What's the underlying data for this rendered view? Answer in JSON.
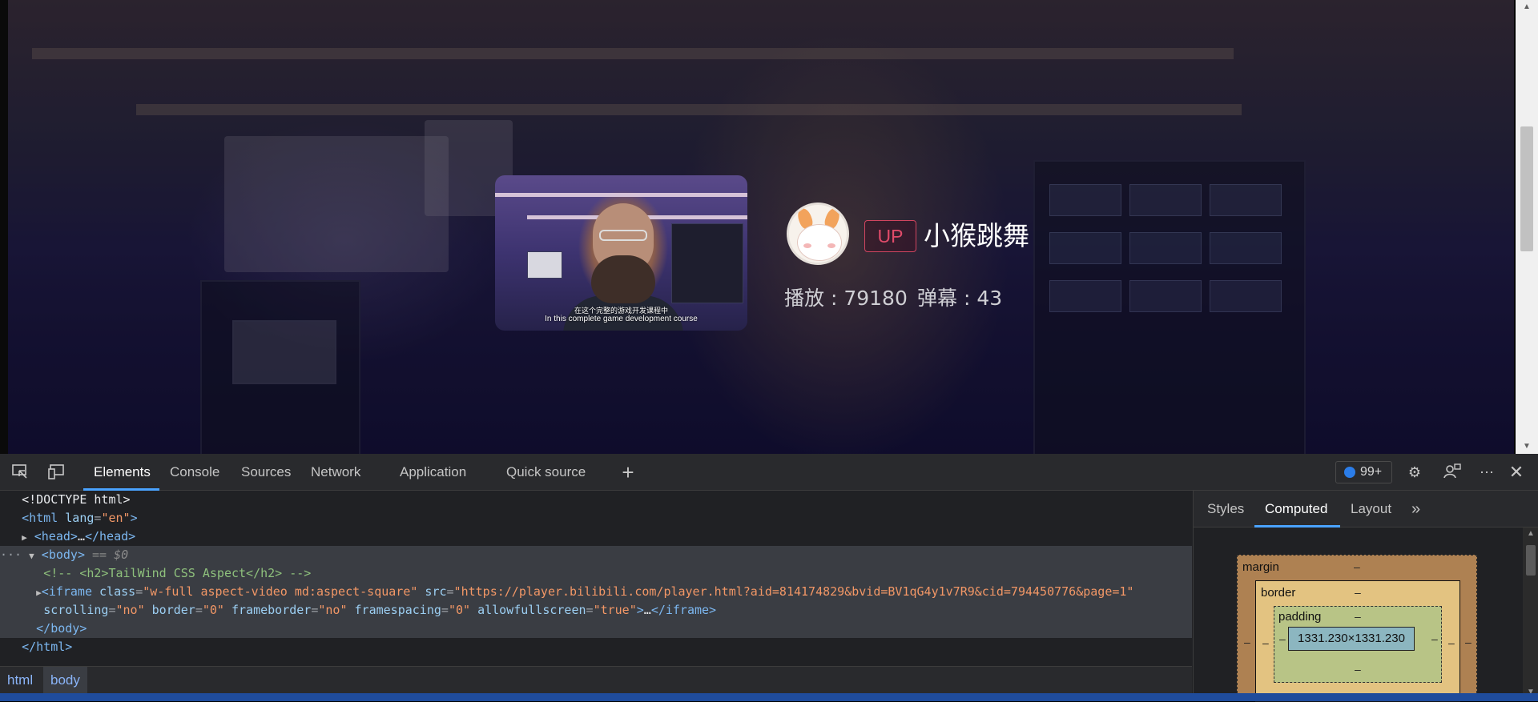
{
  "page": {
    "card": {
      "subtitle_cn": "在这个完整的游戏开发课程中",
      "subtitle_en": "In this complete game development course",
      "thumb_badge": "",
      "up_label": "UP",
      "uploader_name": "小猴跳舞",
      "plays": "播放 : 79180",
      "danmaku": "弹幕 : 43"
    }
  },
  "devtools": {
    "tabs": [
      "Elements",
      "Console",
      "Sources",
      "Network",
      "Application",
      "Quick source"
    ],
    "active_tab": "Elements",
    "issues_count": "99+",
    "dom": {
      "doctype": "<!DOCTYPE html>",
      "html_open_tag": "html",
      "html_lang_attr": "lang",
      "html_lang_val": "\"en\"",
      "head_tag": "head",
      "head_ellipsis": "…",
      "body_tag": "body",
      "body_eq": "== $0",
      "comment": "<!-- <h2>TailWind CSS Aspect</h2> -->",
      "iframe_tag": "iframe",
      "iframe_class_attr": "class",
      "iframe_class_val": "\"w-full aspect-video md:aspect-square\"",
      "iframe_src_attr": "src",
      "iframe_src_val": "\"https://player.bilibili.com/player.html?aid=814174829&bvid=BV1qG4y1v7R9&cid=794450776&page=1\"",
      "scrolling_attr": "scrolling",
      "scrolling_val": "\"no\"",
      "border_attr": "border",
      "border_val": "\"0\"",
      "frameborder_attr": "frameborder",
      "frameborder_val": "\"no\"",
      "framespacing_attr": "framespacing",
      "framespacing_val": "\"0\"",
      "allowfullscreen_attr": "allowfullscreen",
      "allowfullscreen_val": "\"true\"",
      "iframe_ellipsis": "…",
      "body_close": "</body>",
      "html_close": "</html>"
    },
    "breadcrumbs": [
      "html",
      "body"
    ],
    "side_tabs": [
      "Styles",
      "Computed",
      "Layout"
    ],
    "active_side_tab": "Computed",
    "box_model": {
      "margin_label": "margin",
      "border_label": "border",
      "padding_label": "padding",
      "dash": "–",
      "content_size": "1331.230×1331.230"
    },
    "icons": [
      "inspect-icon",
      "device-toolbar-icon",
      "add-tab-icon",
      "issues-icon",
      "settings-icon",
      "feedback-icon",
      "more-icon",
      "close-icon",
      "more-tabs-icon"
    ]
  }
}
